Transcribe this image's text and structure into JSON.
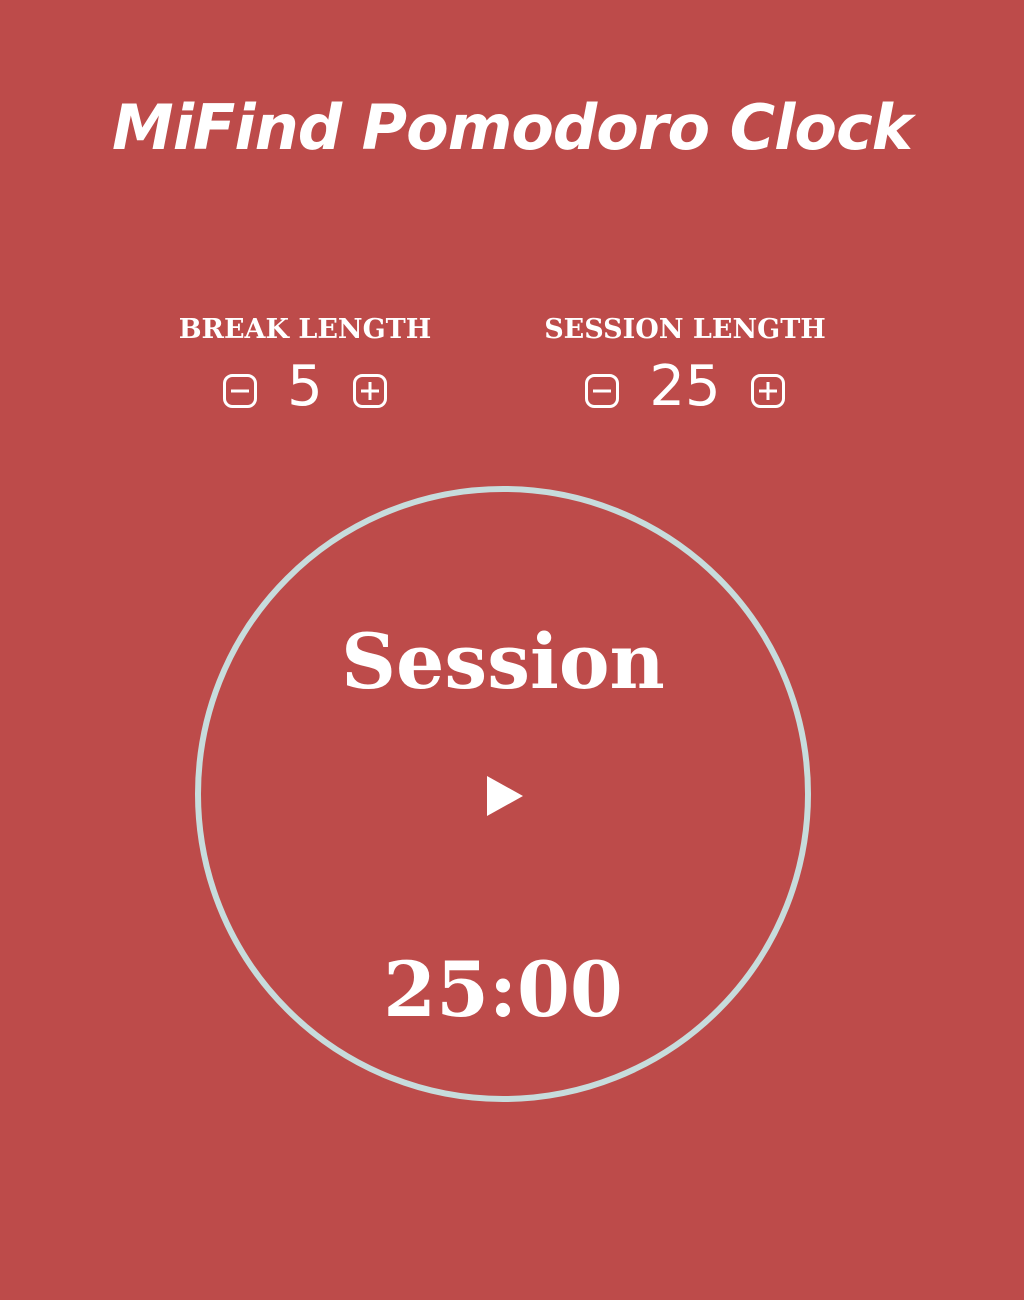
{
  "app": {
    "title": "MiFind Pomodoro Clock"
  },
  "break_control": {
    "label": "BREAK LENGTH",
    "value": "5",
    "decrement_icon": "minus-square-icon",
    "increment_icon": "plus-square-icon"
  },
  "session_control": {
    "label": "SESSION LENGTH",
    "value": "25",
    "decrement_icon": "minus-square-icon",
    "increment_icon": "plus-square-icon"
  },
  "timer": {
    "mode_label": "Session",
    "time": "25:00",
    "play_icon": "play-icon"
  },
  "colors": {
    "background": "#bd4b4a",
    "ring": "#c7dcdc",
    "text": "#ffffff"
  }
}
